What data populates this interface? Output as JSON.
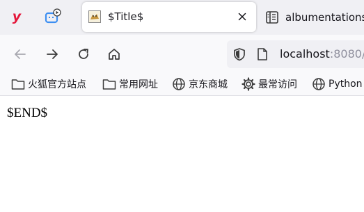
{
  "tabs": {
    "active_title": "$Title$",
    "inactive_title": "albumentations"
  },
  "urlbar": {
    "host": "localhost",
    "port": ":8080/"
  },
  "bookmarks": [
    {
      "label": "火狐官方站点",
      "icon": "folder-icon"
    },
    {
      "label": "常用网址",
      "icon": "folder-icon"
    },
    {
      "label": "京东商城",
      "icon": "globe-icon"
    },
    {
      "label": "最常访问",
      "icon": "gear-icon"
    },
    {
      "label": "Python",
      "icon": "globe-icon"
    }
  ],
  "content": {
    "text": "$END$"
  },
  "colors": {
    "accent_red": "#e4163a",
    "accent_blue": "#3d8ff2"
  }
}
